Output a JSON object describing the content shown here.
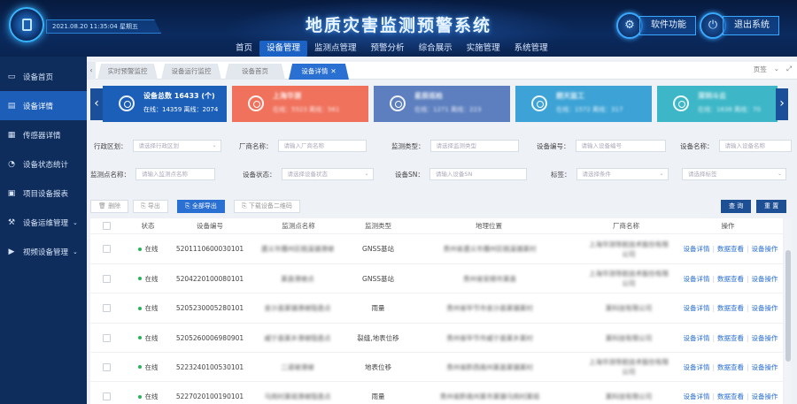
{
  "header": {
    "title": "地质灾害监测预警系统",
    "datetime": "2021.08.20 11:35:04 星期五",
    "nav": [
      "首页",
      "设备管理",
      "监测点管理",
      "预警分析",
      "综合展示",
      "实施管理",
      "系统管理"
    ],
    "nav_active": "设备管理",
    "software_btn": "软件功能",
    "logout_btn": "退出系统"
  },
  "sidebar": {
    "items": [
      {
        "label": "设备首页",
        "icon": "monitor-icon"
      },
      {
        "label": "设备详情",
        "icon": "detail-icon"
      },
      {
        "label": "传感器详情",
        "icon": "sensor-icon"
      },
      {
        "label": "设备状态统计",
        "icon": "stats-icon"
      },
      {
        "label": "项目设备报表",
        "icon": "report-icon"
      },
      {
        "label": "设备运维管理",
        "icon": "maintenance-icon",
        "arrow": "⌄"
      },
      {
        "label": "视频设备管理",
        "icon": "video-icon",
        "arrow": "⌄"
      }
    ]
  },
  "tabs": {
    "back": "‹",
    "items": [
      {
        "label": "实时预警监控"
      },
      {
        "label": "设备运行监控"
      },
      {
        "label": "设备首页"
      },
      {
        "label": "设备详情",
        "close": "✕"
      }
    ],
    "right_label": "页签",
    "right_icons": [
      "⌄",
      "⤢"
    ]
  },
  "cards": {
    "prev": "‹",
    "next": "›",
    "items": [
      {
        "title": "设备总数 16433 (个)",
        "sub": "在线：14359 离线：2074",
        "color": "#1b5fb8"
      },
      {
        "title": "上海华测",
        "sub": "在线：5523 离线：561",
        "color": "#f0725d"
      },
      {
        "title": "星辰巡检",
        "sub": "在线：1271 离线：223",
        "color": "#5d7fbf"
      },
      {
        "title": "朗天监工",
        "sub": "在线：1572 离线：317",
        "color": "#3da3d6"
      },
      {
        "title": "深圳斗云",
        "sub": "在线：1638 离线：70",
        "color": "#3db7c7"
      }
    ]
  },
  "filters": {
    "region": {
      "label": "行政区划：",
      "placeholder": "请选择行政区划"
    },
    "vendor": {
      "label": "厂商名称：",
      "placeholder": "请输入厂商名称"
    },
    "mtype": {
      "label": "监测类型：",
      "placeholder": "请选择监测类型"
    },
    "devno": {
      "label": "设备编号：",
      "placeholder": "请输入设备编号"
    },
    "devname": {
      "label": "设备名称：",
      "placeholder": "请输入设备名称"
    },
    "point": {
      "label": "监测点名称：",
      "placeholder": "请输入监测点名称"
    },
    "status": {
      "label": "设备状态：",
      "placeholder": "请选择设备状态"
    },
    "sn": {
      "label": "设备SN：",
      "placeholder": "请输入设备SN"
    },
    "tag": {
      "label": "标签：",
      "placeholder": "请选择条件"
    },
    "tag2": {
      "placeholder": "请选择标签"
    }
  },
  "toolbar": {
    "delete": "删除",
    "export": "导出",
    "export_all": "全部导出",
    "qrcode": "下载设备二维码",
    "query": "查 询",
    "reset": "重 置"
  },
  "table": {
    "headers": [
      "状态",
      "设备编号",
      "监测点名称",
      "监测类型",
      "地理位置",
      "厂商名称",
      "操作"
    ],
    "ops": [
      "设备详情",
      "数据查看",
      "设备操作"
    ],
    "rows": [
      {
        "status": "在线",
        "id": "5201110600030101",
        "point": "遵义市播州区桃溪镇滑坡",
        "type": "GNSS基站",
        "loc": "贵州省遵义市播州区桃溪镇某村",
        "vendor": "上海华测导航技术股份有限公司"
      },
      {
        "status": "在线",
        "id": "5204220100080101",
        "point": "某县滑坡点",
        "type": "GNSS基站",
        "loc": "贵州省安顺市某县",
        "vendor": "上海华测导航技术股份有限公司"
      },
      {
        "status": "在线",
        "id": "5205230005280101",
        "point": "金沙县某镇滑坡隐患点",
        "type": "雨量",
        "loc": "贵州省毕节市金沙县某镇某村",
        "vendor": "某科技有限公司"
      },
      {
        "status": "在线",
        "id": "5205260006980901",
        "point": "威宁县某乡滑坡隐患点",
        "type": "裂缝,地表位移",
        "loc": "贵州省毕节市威宁县某乡某村",
        "vendor": "某科技有限公司"
      },
      {
        "status": "在线",
        "id": "5223240100530101",
        "point": "二道坡滑坡",
        "type": "地表位移",
        "loc": "贵州省黔西南州某县某镇某村",
        "vendor": "上海华测导航技术股份有限公司"
      },
      {
        "status": "在线",
        "id": "5227020100190101",
        "point": "马岗村某组滑坡隐患点",
        "type": "雨量",
        "loc": "贵州省黔南州某市某镇马岗村某组",
        "vendor": "某科技有限公司"
      }
    ]
  }
}
